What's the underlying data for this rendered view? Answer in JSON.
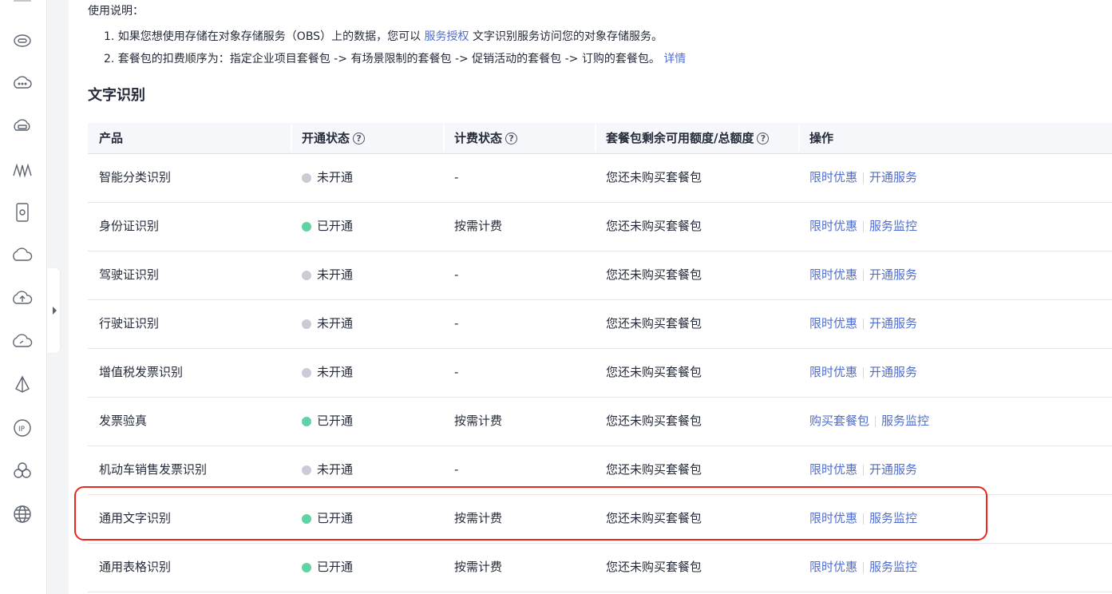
{
  "usage": {
    "title": "使用说明：",
    "line1_prefix": "1. 如果您想使用存储在对象存储服务（OBS）上的数据，您可以 ",
    "line1_link": "服务授权",
    "line1_suffix": " 文字识别服务访问您的对象存储服务。",
    "line2_prefix": "2. 套餐包的扣费顺序为：指定企业项目套餐包 -> 有场景限制的套餐包 -> 促销活动的套餐包 -> 订购的套餐包。",
    "line2_link": "详情"
  },
  "section_title": "文字识别",
  "table": {
    "headers": {
      "product": "产品",
      "status": "开通状态",
      "billing": "计费状态",
      "quota": "套餐包剩余可用额度/总额度",
      "ops": "操作"
    },
    "rows": [
      {
        "product": "智能分类识别",
        "status": "未开通",
        "billing": "-",
        "quota": "您还未购买套餐包",
        "op1": "限时优惠",
        "op2": "开通服务"
      },
      {
        "product": "身份证识别",
        "status": "已开通",
        "billing": "按需计费",
        "quota": "您还未购买套餐包",
        "op1": "限时优惠",
        "op2": "服务监控"
      },
      {
        "product": "驾驶证识别",
        "status": "未开通",
        "billing": "-",
        "quota": "您还未购买套餐包",
        "op1": "限时优惠",
        "op2": "开通服务"
      },
      {
        "product": "行驶证识别",
        "status": "未开通",
        "billing": "-",
        "quota": "您还未购买套餐包",
        "op1": "限时优惠",
        "op2": "开通服务"
      },
      {
        "product": "增值税发票识别",
        "status": "未开通",
        "billing": "-",
        "quota": "您还未购买套餐包",
        "op1": "限时优惠",
        "op2": "开通服务"
      },
      {
        "product": "发票验真",
        "status": "已开通",
        "billing": "按需计费",
        "quota": "您还未购买套餐包",
        "op1": "购买套餐包",
        "op2": "服务监控"
      },
      {
        "product": "机动车销售发票识别",
        "status": "未开通",
        "billing": "-",
        "quota": "您还未购买套餐包",
        "op1": "限时优惠",
        "op2": "开通服务"
      },
      {
        "product": "通用文字识别",
        "status": "已开通",
        "billing": "按需计费",
        "quota": "您还未购买套餐包",
        "op1": "限时优惠",
        "op2": "服务监控"
      },
      {
        "product": "通用表格识别",
        "status": "已开通",
        "billing": "按需计费",
        "quota": "您还未购买套餐包",
        "op1": "限时优惠",
        "op2": "服务监控"
      }
    ]
  },
  "colors": {
    "link": "#526ecc",
    "status_on": "#5fd3a4",
    "status_off": "#c9ccd4",
    "highlight_border": "#e8271e",
    "header_bg": "#f5f7fb"
  },
  "sidebar_icons": [
    "obs-icon",
    "cloud-chat-icon",
    "storage-icon",
    "waveform-icon",
    "device-icon",
    "cloud-icon",
    "cloud-upload-icon",
    "cloud-refresh-icon",
    "network-icon",
    "ip-icon",
    "cluster-icon",
    "globe-icon"
  ]
}
